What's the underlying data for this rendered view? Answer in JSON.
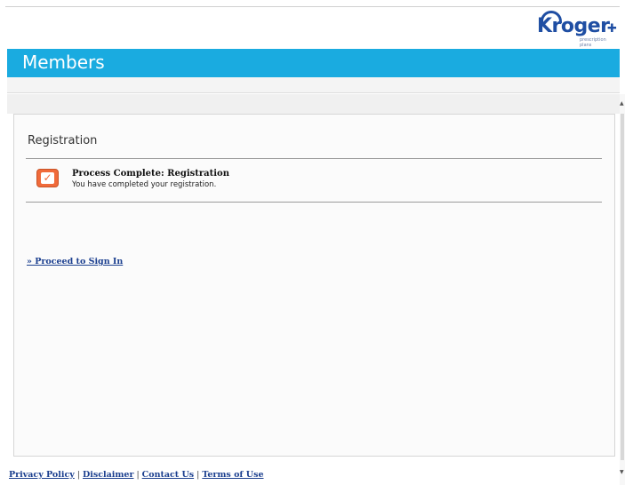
{
  "brand": {
    "logo_text": "Kroger",
    "logo_plus": "✚",
    "logo_subtext": "prescription plans",
    "accent_color": "#1aabe0",
    "logo_color": "#1f4ea3"
  },
  "header": {
    "title": "Members"
  },
  "main": {
    "heading": "Registration",
    "status": {
      "icon": "check-icon",
      "icon_glyph": "✓",
      "title": "Process Complete: Registration",
      "message": "You have completed your registration."
    },
    "proceed_link": "» Proceed to Sign In"
  },
  "footer": {
    "links": [
      "Privacy Policy",
      "Disclaimer",
      "Contact Us",
      "Terms of Use"
    ],
    "separator": "|"
  },
  "scrollbar": {
    "up_glyph": "▲",
    "down_glyph": "▼"
  }
}
